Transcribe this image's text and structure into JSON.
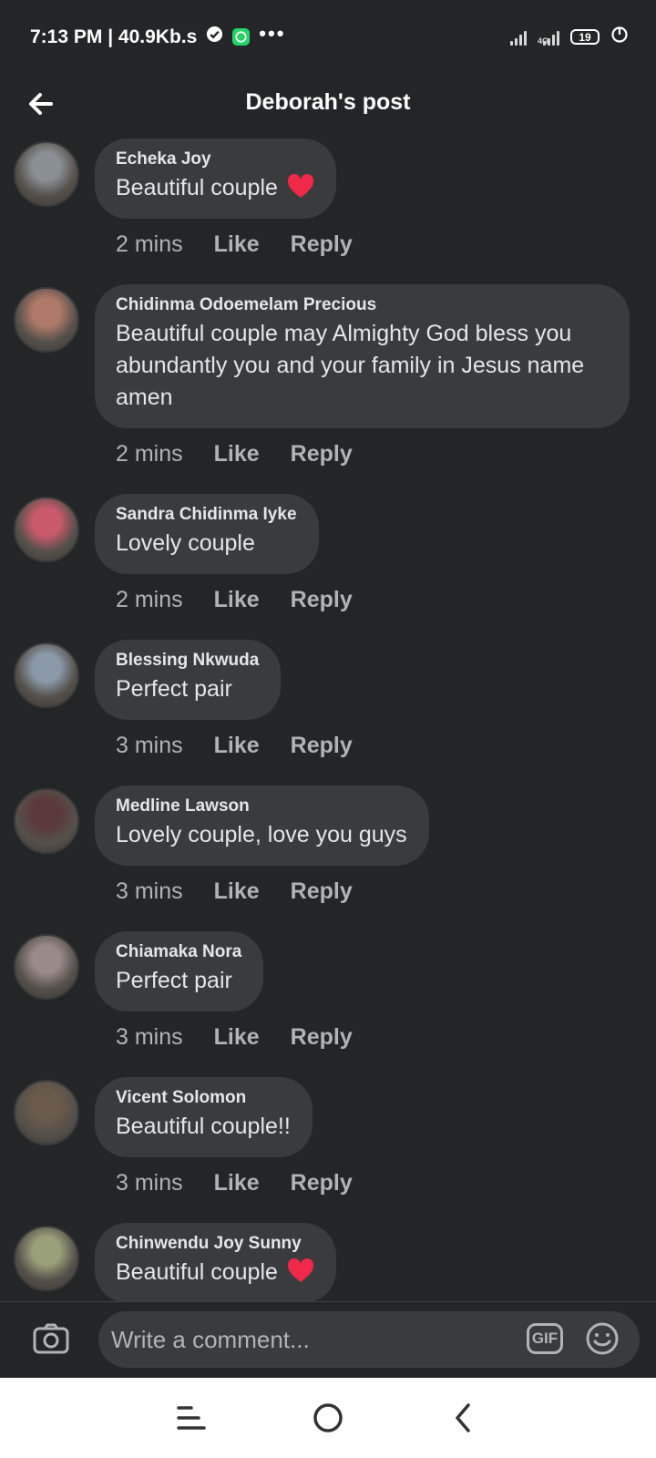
{
  "status_bar": {
    "time": "7:13 PM | 40.9Kb.s",
    "dots": "•••",
    "network": "4G",
    "battery": "19"
  },
  "header": {
    "title": "Deborah's post"
  },
  "comments": [
    {
      "author": "Echeka Joy",
      "text": "Beautiful couple",
      "heart": true,
      "time": "2 mins",
      "like": "Like",
      "reply": "Reply",
      "avatar_color": "#8a8f95"
    },
    {
      "author": "Chidinma Odoemelam Precious",
      "text": "Beautiful couple may Almighty God bless you abundantly you and your family in Jesus name amen",
      "heart": false,
      "time": "2 mins",
      "like": "Like",
      "reply": "Reply",
      "avatar_color": "#b07a6a"
    },
    {
      "author": "Sandra Chidinma Iyke",
      "text": "Lovely couple",
      "heart": false,
      "time": "2 mins",
      "like": "Like",
      "reply": "Reply",
      "avatar_color": "#c85a6a"
    },
    {
      "author": "Blessing Nkwuda",
      "text": "Perfect pair",
      "heart": false,
      "time": "3 mins",
      "like": "Like",
      "reply": "Reply",
      "avatar_color": "#8a9aaa"
    },
    {
      "author": "Medline Lawson",
      "text": "Lovely couple, love you guys",
      "heart": false,
      "time": "3 mins",
      "like": "Like",
      "reply": "Reply",
      "avatar_color": "#5a3a3a"
    },
    {
      "author": "Chiamaka Nora",
      "text": "Perfect pair",
      "heart": false,
      "time": "3 mins",
      "like": "Like",
      "reply": "Reply",
      "avatar_color": "#9a8a8a"
    },
    {
      "author": "Vicent Solomon",
      "text": "Beautiful couple!!",
      "heart": false,
      "time": "3 mins",
      "like": "Like",
      "reply": "Reply",
      "avatar_color": "#6a5a4a"
    },
    {
      "author": "Chinwendu Joy Sunny",
      "text": "Beautiful couple",
      "heart": true,
      "time": "",
      "like": "",
      "reply": "",
      "avatar_color": "#9aa07a"
    }
  ],
  "composer": {
    "placeholder": "Write a comment...",
    "gif_label": "GIF"
  },
  "colors": {
    "background": "#242526",
    "bubble": "#3a3b3c",
    "heart": "#f02849"
  }
}
